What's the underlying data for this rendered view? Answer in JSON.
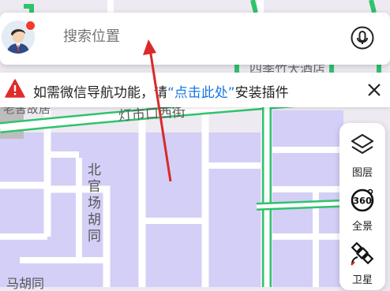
{
  "search": {
    "placeholder": "搜索位置"
  },
  "notice": {
    "prefix": "如需微信导航功能，请",
    "link": "“点击此处”",
    "suffix": "安装插件"
  },
  "tools": [
    {
      "label": "图层",
      "icon": "layers-icon"
    },
    {
      "label": "全景",
      "icon": "panorama-360-icon"
    },
    {
      "label": "卫星",
      "icon": "satellite-icon"
    }
  ],
  "map": {
    "labels": {
      "street_east": "灯市口西街",
      "alley": "北官场胡同",
      "hotel": "四季竹大酒店",
      "hutong_partial": "老舍故居",
      "bottom_partial": "马胡同"
    }
  },
  "colors": {
    "accent": "#1677e5",
    "road_green": "#2fc36d",
    "block_purple": "#d3cff6",
    "warning_red": "#e02b2b",
    "badge_red": "#f03b30"
  }
}
